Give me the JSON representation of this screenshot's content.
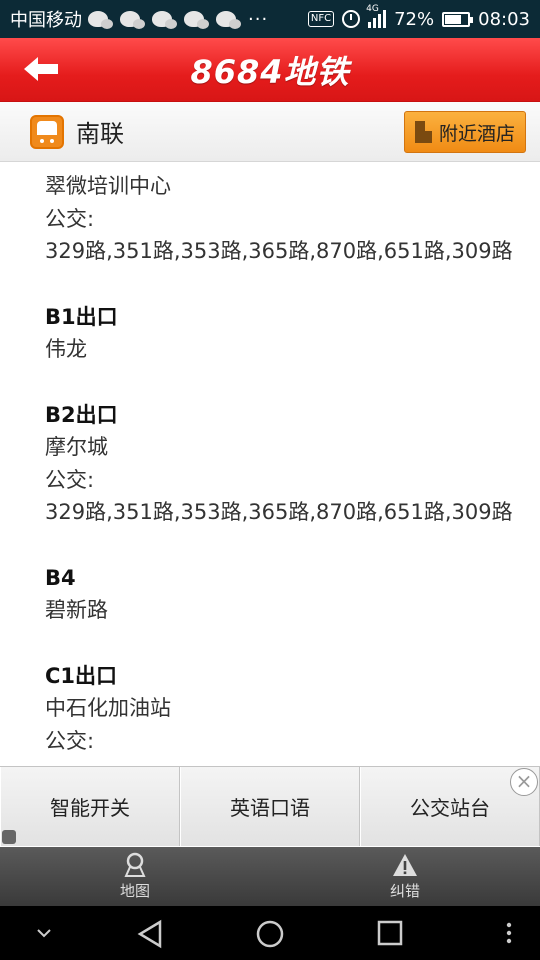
{
  "status_bar": {
    "carrier": "中国移动",
    "more": "···",
    "nfc": "NFC",
    "network": "4G",
    "battery_percent": "72%",
    "battery_level": 0.72,
    "time": "08:03"
  },
  "app_bar": {
    "title": "8684地铁",
    "back_icon": "back-arrow-icon"
  },
  "station_bar": {
    "station_name": "南联",
    "nearby_hotel_label": "附近酒店"
  },
  "exits": [
    {
      "title": "",
      "place": "翠微培训中心",
      "bus_label": "公交:",
      "bus_routes": "329路,351路,353路,365路,870路,651路,309路"
    },
    {
      "title": "B1出口",
      "place": "伟龙",
      "bus_label": "",
      "bus_routes": ""
    },
    {
      "title": "B2出口",
      "place": "摩尔城",
      "bus_label": "公交:",
      "bus_routes": "329路,351路,353路,365路,870路,651路,309路"
    },
    {
      "title": "B4",
      "place": "碧新路",
      "bus_label": "",
      "bus_routes": ""
    },
    {
      "title": "C1出口",
      "place": "中石化加油站",
      "bus_label": "公交:",
      "bus_routes": ""
    }
  ],
  "ad_bar": {
    "buttons": [
      "智能开关",
      "英语口语",
      "公交站台"
    ],
    "close_label": "×"
  },
  "tab_bar": {
    "tabs": [
      {
        "label": "地图",
        "icon": "map-pin-icon"
      },
      {
        "label": "纠错",
        "icon": "warning-icon"
      }
    ]
  },
  "colors": {
    "header_red": "#e51c1c",
    "hotel_orange": "#f08b14",
    "status_bar": "#0c2a36"
  }
}
